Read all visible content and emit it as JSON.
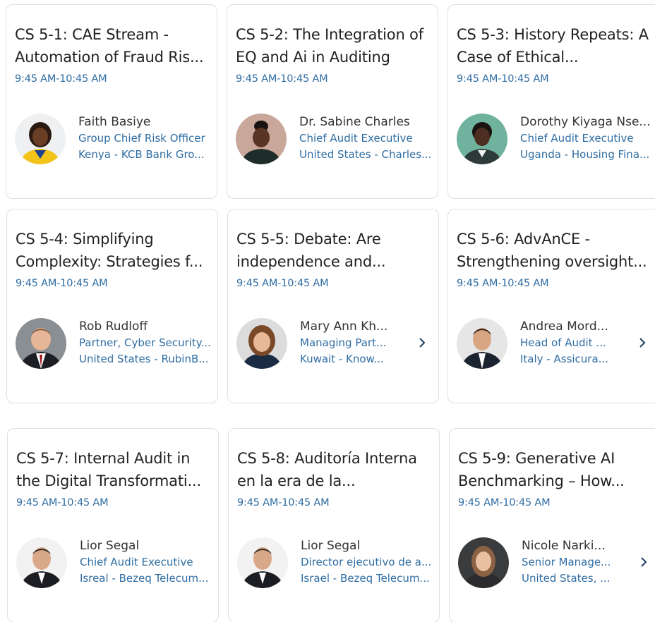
{
  "sessions": [
    {
      "title_line1": "CS 5-1: CAE Stream -",
      "title_line2": "Automation of Fraud Ris...",
      "time": "9:45 AM-10:45 AM",
      "speaker": {
        "name": "Faith Basiye",
        "role": "Group Chief Risk Officer",
        "org": "Kenya - KCB Bank Gro..."
      },
      "has_more": false
    },
    {
      "title_line1": "CS 5-2: The Integration of",
      "title_line2": "EQ and Ai in Auditing",
      "time": "9:45 AM-10:45 AM",
      "speaker": {
        "name": "Dr. Sabine Charles",
        "role": "Chief Audit Executive",
        "org": "United States - Charles..."
      },
      "has_more": false
    },
    {
      "title_line1": "CS 5-3: History Repeats: A",
      "title_line2": "Case of Ethical...",
      "time": "9:45 AM-10:45 AM",
      "speaker": {
        "name": "Dorothy Kiyaga Nse...",
        "role": "Chief Audit Executive",
        "org": "Uganda - Housing Fina..."
      },
      "has_more": false
    },
    {
      "title_line1": "CS 5-4: Simplifying",
      "title_line2": "Complexity: Strategies f...",
      "time": "9:45 AM-10:45 AM",
      "speaker": {
        "name": "Rob Rudloff",
        "role": "Partner, Cyber Security...",
        "org": "United States - RubinB..."
      },
      "has_more": false
    },
    {
      "title_line1": "CS 5-5: Debate: Are",
      "title_line2": "independence and...",
      "time": "9:45 AM-10:45 AM",
      "speaker": {
        "name": "Mary Ann Kh...",
        "role": "Managing Part...",
        "org": "Kuwait - Know..."
      },
      "has_more": true
    },
    {
      "title_line1": "CS 5-6: AdvAnCE -",
      "title_line2": "Strengthening oversight...",
      "time": "9:45 AM-10:45 AM",
      "speaker": {
        "name": "Andrea Mord...",
        "role": "Head of Audit ...",
        "org": "Italy - Assicura..."
      },
      "has_more": true
    },
    {
      "title_line1": "CS 5-7: Internal Audit in",
      "title_line2": "the Digital Transformati...",
      "time": "9:45 AM-10:45 AM",
      "speaker": {
        "name": "Lior Segal",
        "role": "Chief Audit Executive",
        "org": "Isreal - Bezeq Telecum..."
      },
      "has_more": false
    },
    {
      "title_line1": "CS 5-8: Auditoría Interna",
      "title_line2": "en la era de la...",
      "time": "9:45 AM-10:45 AM",
      "speaker": {
        "name": "Lior Segal",
        "role": "Director ejecutivo de a...",
        "org": "Israel - Bezeq Telecum..."
      },
      "has_more": false
    },
    {
      "title_line1": "CS 5-9: Generative AI",
      "title_line2": "Benchmarking – How...",
      "time": "9:45 AM-10:45 AM",
      "speaker": {
        "name": "Nicole Narki...",
        "role": "Senior Manage...",
        "org": "United States, ..."
      },
      "has_more": true
    }
  ],
  "icons": {
    "more_speakers": "chevron-right-icon",
    "speaker_photo": "avatar"
  },
  "colors": {
    "link_blue": "#2f6da3",
    "title_text": "#222222",
    "card_border": "#e0e0e0"
  }
}
